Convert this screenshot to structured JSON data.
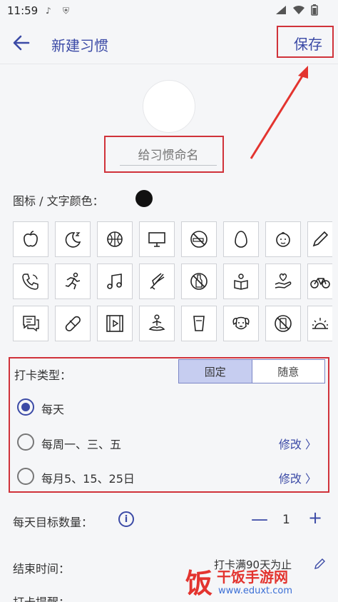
{
  "status_bar": {
    "time": "11:59"
  },
  "app_bar": {
    "title": "新建习惯",
    "save_label": "保存"
  },
  "habit_name": {
    "placeholder": "给习惯命名"
  },
  "color_section": {
    "label": "图标 / 文字颜色：",
    "selected_color": "#111111"
  },
  "icons": [
    "apple-icon",
    "moon-sleep-icon",
    "basketball-icon",
    "monitor-icon",
    "no-smoking-icon",
    "egg-icon",
    "baby-icon",
    "pencil-icon",
    "phone-icon",
    "running-icon",
    "music-note-icon",
    "badminton-icon",
    "no-drinking-icon",
    "reading-icon",
    "heart-hand-icon",
    "bicycle-icon",
    "chat-icon",
    "pill-icon",
    "film-icon",
    "meditation-icon",
    "cup-icon",
    "dog-icon",
    "no-phone-icon",
    "sunrise-icon"
  ],
  "check_type": {
    "label": "打卡类型：",
    "segments": [
      "固定",
      "随意"
    ],
    "options": [
      {
        "text": "每天",
        "selected": true,
        "edit": ""
      },
      {
        "text": "每周一、三、五",
        "selected": false,
        "edit": "修改 〉"
      },
      {
        "text": "每月5、15、25日",
        "selected": false,
        "edit": "修改 〉"
      }
    ]
  },
  "target": {
    "label": "每天目标数量：",
    "count": "1",
    "minus": "—",
    "plus": "+"
  },
  "end_time": {
    "label": "结束时间：",
    "value": "打卡满90天为止"
  },
  "reminder": {
    "label": "打卡提醒："
  },
  "watermark": {
    "char": "饭",
    "brand": "干饭手游网",
    "url": "www.eduxt.com"
  },
  "colors": {
    "accent": "#3b4aa6",
    "annotation": "#d0323a",
    "selected_segment": "#c6cdf0"
  }
}
